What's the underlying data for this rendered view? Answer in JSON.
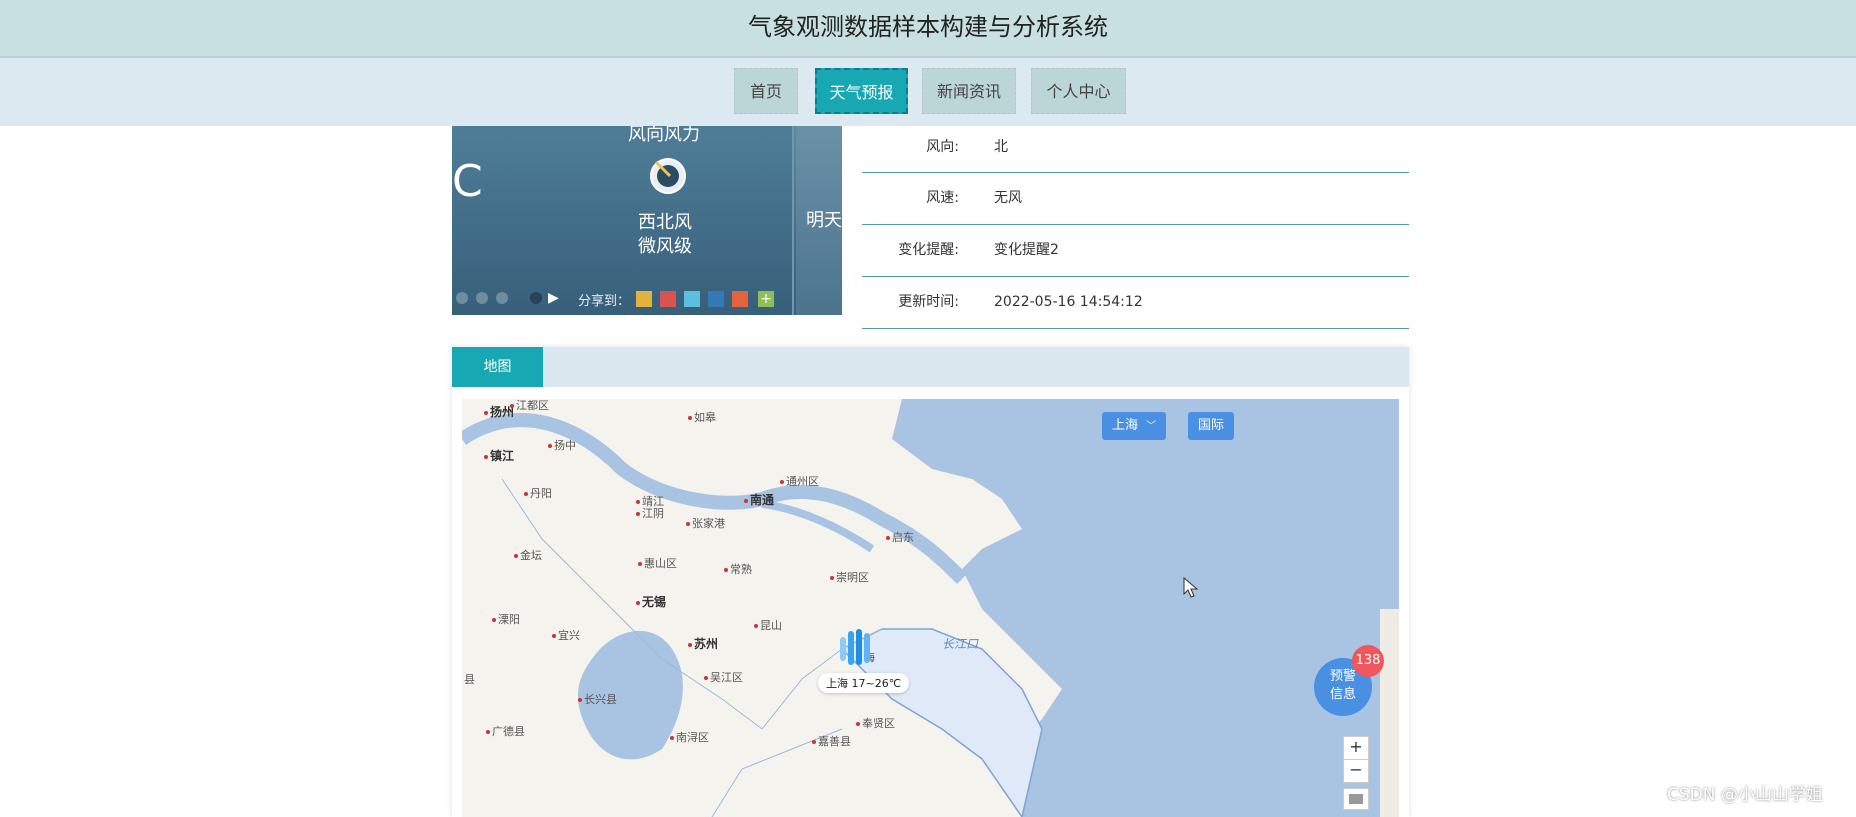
{
  "app_title": "气象观测数据样本构建与分析系统",
  "nav": [
    {
      "label": "首页",
      "active": false
    },
    {
      "label": "天气预报",
      "active": true
    },
    {
      "label": "新闻资讯",
      "active": false
    },
    {
      "label": "个人中心",
      "active": false
    }
  ],
  "weather_image": {
    "wind_title": "风向风力",
    "wind_desc_line1": "西北风",
    "wind_desc_line2": "微风级",
    "tomorrow": "明天",
    "share": "分享到：",
    "big_c": "C"
  },
  "details": [
    {
      "label": "风向:",
      "value": "北"
    },
    {
      "label": "风速:",
      "value": "无风"
    },
    {
      "label": "变化提醒:",
      "value": "变化提醒2"
    },
    {
      "label": "更新时间:",
      "value": "2022-05-16 14:54:12"
    }
  ],
  "map": {
    "tab_label": "地图",
    "region_button": "上海",
    "intl_button": "国际",
    "warning_label_line1": "预警",
    "warning_label_line2": "信息",
    "warning_count": "138",
    "zoom_in": "+",
    "zoom_out": "−",
    "marker_label": "上海 17~26℃",
    "river_label": "长江口",
    "cities": [
      {
        "name": "扬州",
        "big": true
      },
      {
        "name": "江都区",
        "big": false
      },
      {
        "name": "如皋",
        "big": false
      },
      {
        "name": "镇江",
        "big": true
      },
      {
        "name": "扬中",
        "big": false
      },
      {
        "name": "丹阳",
        "big": false
      },
      {
        "name": "靖江",
        "big": false
      },
      {
        "name": "江阴",
        "big": false
      },
      {
        "name": "南通",
        "big": true
      },
      {
        "name": "通州区",
        "big": false
      },
      {
        "name": "张家港",
        "big": false
      },
      {
        "name": "启东",
        "big": false
      },
      {
        "name": "金坛",
        "big": false
      },
      {
        "name": "惠山区",
        "big": false
      },
      {
        "name": "常熟",
        "big": false
      },
      {
        "name": "崇明区",
        "big": false
      },
      {
        "name": "无锡",
        "big": true
      },
      {
        "name": "溧阳",
        "big": false
      },
      {
        "name": "宜兴",
        "big": false
      },
      {
        "name": "苏州",
        "big": true
      },
      {
        "name": "昆山",
        "big": false
      },
      {
        "name": "吴江区",
        "big": false
      },
      {
        "name": "长兴县",
        "big": false
      },
      {
        "name": "广德县",
        "big": false
      },
      {
        "name": "南浔区",
        "big": false
      },
      {
        "name": "嘉善县",
        "big": false
      },
      {
        "name": "奉贤区",
        "big": false
      },
      {
        "name": "县",
        "big": false
      },
      {
        "name": "海",
        "big": false
      }
    ]
  },
  "watermark": "CSDN @小山山学姐"
}
